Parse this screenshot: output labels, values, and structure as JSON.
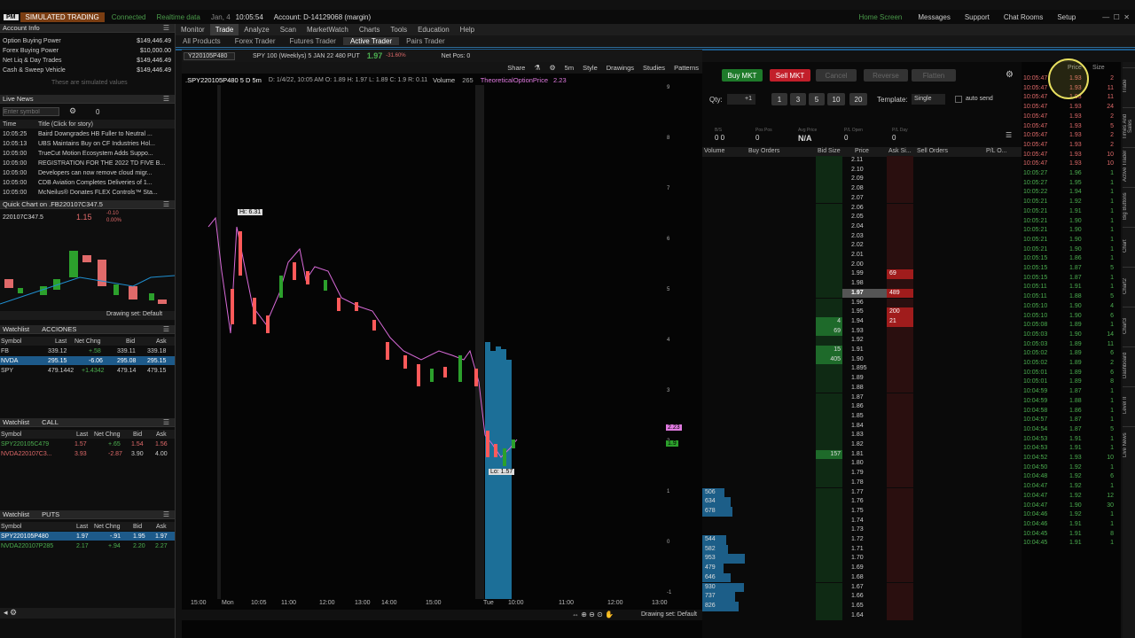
{
  "topbar": {
    "logo": "PM",
    "mode": "SIMULATED TRADING",
    "status": "Connected",
    "realtime": "Realtime data",
    "date": "Jan, 4",
    "time": "10:05:54",
    "account": "Account: D-14129068 (margin)",
    "home": "Home Screen",
    "messages": "Messages",
    "support": "Support",
    "chat": "Chat Rooms",
    "setup": "Setup"
  },
  "menu": [
    "Monitor",
    "Trade",
    "Analyze",
    "Scan",
    "MarketWatch",
    "Charts",
    "Tools",
    "Education",
    "Help"
  ],
  "subtabs": [
    "All Products",
    "Forex Trader",
    "Futures Trader",
    "Active Trader",
    "Pairs Trader"
  ],
  "account": {
    "title": "Account Info",
    "rows": [
      {
        "l": "Option Buying Power",
        "v": "$149,446.49"
      },
      {
        "l": "Forex Buying Power",
        "v": "$10,000.00"
      },
      {
        "l": "Net Liq & Day Trades",
        "v": "$149,446.49"
      },
      {
        "l": "Cash & Sweep Vehicle",
        "v": "$149,446.49"
      }
    ],
    "note": "These are simulated values"
  },
  "news": {
    "title": "Live News",
    "placeholder": "Enter symbol",
    "count": "0",
    "col_time": "Time",
    "col_title": "Title (Click for story)",
    "items": [
      {
        "t": "10:05:25",
        "h": "Baird Downgrades HB Fuller to Neutral ..."
      },
      {
        "t": "10:05:13",
        "h": "UBS Maintains Buy on CF Industries Hol..."
      },
      {
        "t": "10:05:00",
        "h": "TrueCut Motion Ecosystem Adds Suppo..."
      },
      {
        "t": "10:05:00",
        "h": "REGISTRATION FOR THE 2022 TD FIVE B..."
      },
      {
        "t": "10:05:00",
        "h": "Developers can now remove cloud migr..."
      },
      {
        "t": "10:05:00",
        "h": "CDB Aviation Completes Deliveries of 1..."
      },
      {
        "t": "10:05:00",
        "h": "McNeilus® Donates FLEX Controls™ Sta..."
      }
    ]
  },
  "quickchart": {
    "title": "Quick Chart on .FB220107C347.5",
    "symbol": "220107C347.5",
    "price": "1.15",
    "chg": "-0.10",
    "pct": "0.00%",
    "footer": "Drawing set: Default"
  },
  "wl1": {
    "title": "Watchlist",
    "name": "ACCIONES",
    "cols": [
      "Symbol",
      "Last",
      "Net Chng",
      "Bid",
      "Ask"
    ],
    "rows": [
      [
        "FB",
        "339.12",
        "+.58",
        "339.11",
        "339.18"
      ],
      [
        "NVDA",
        "295.15",
        "-6.06",
        "295.08",
        "295.15"
      ],
      [
        "SPY",
        "479.1442",
        "+1.4342",
        "479.14",
        "479.15"
      ]
    ]
  },
  "wl2": {
    "title": "Watchlist",
    "name": "CALL",
    "cols": [
      "Symbol",
      "Last",
      "Net Chng",
      "Bid",
      "Ask"
    ],
    "rows": [
      [
        "SPY220105C479",
        "1.57",
        "+.65",
        "1.54",
        "1.56"
      ],
      [
        "NVDA220107C3...",
        "3.93",
        "-2.87",
        "3.90",
        "4.00"
      ]
    ]
  },
  "wl3": {
    "title": "Watchlist",
    "name": "PUTS",
    "cols": [
      "Symbol",
      "Last",
      "Net Chng",
      "Bid",
      "Ask"
    ],
    "rows": [
      [
        "SPY220105P480",
        "1.97",
        "-.91",
        "1.95",
        "1.97"
      ],
      [
        "NVDA220107P285",
        "2.17",
        "+.94",
        "2.20",
        "2.27"
      ]
    ]
  },
  "chart": {
    "symbol": "Y220105P480",
    "desc": "SPY 100 (Weeklys) 5 JAN 22 480 PUT",
    "last": "1.97",
    "chg": "-31.60%",
    "netpos": "Net Pos: 0",
    "share": "Share",
    "tf": "5m",
    "style": "Style",
    "drawings": "Drawings",
    "studies": "Studies",
    "patterns": "Patterns",
    "info": ".SPY220105P480 5 D 5m",
    "ohlc": "D: 1/4/22, 10:05 AM  O: 1.89  H: 1.97  L: 1.89  C: 1.9  R: 0.11",
    "vol_label": "Volume",
    "vol": "265",
    "study": "TheoreticalOptionPrice",
    "study_val": "2.23",
    "hi": "Hi: 6.31",
    "lo": "Lo: 1.57",
    "xlabels": [
      "15:00",
      "Mon",
      "10:05",
      "11:00",
      "12:00",
      "13:00",
      "14:00",
      "15:00",
      "Tue",
      "10:00",
      "11:00",
      "12:00",
      "13:00"
    ],
    "ylabels": [
      "9",
      "8",
      "7",
      "6",
      "5",
      "4",
      "3",
      "2",
      "1",
      "0",
      "-1"
    ],
    "tag1": "2.23",
    "tag2": "1.9",
    "footer": "Drawing set: Default"
  },
  "ladder": {
    "buy": "Buy MKT",
    "sell": "Sell MKT",
    "cancel": "Cancel",
    "reverse": "Reverse",
    "flatten": "Flatten",
    "qty_label": "Qty:",
    "qty": "+1",
    "qtys": [
      "1",
      "3",
      "5",
      "10",
      "20"
    ],
    "template_label": "Template:",
    "template": "Single",
    "autosend": "auto send",
    "stats": [
      {
        "l": "B/S",
        "v": "0  0"
      },
      {
        "l": "Pos Pos",
        "v": "0"
      },
      {
        "l": "Avg Price",
        "v": "N/A"
      },
      {
        "l": "P/L Open",
        "v": "0"
      },
      {
        "l": "P/L Day",
        "v": "0"
      }
    ],
    "cols": [
      "Volume",
      "Buy Orders",
      "Bid Size",
      "Price",
      "Ask Si...",
      "Sell Orders",
      "P/L O..."
    ],
    "rows": [
      {
        "p": "2.11"
      },
      {
        "p": "2.10"
      },
      {
        "p": "2.09"
      },
      {
        "p": "2.08"
      },
      {
        "p": "2.07"
      },
      {
        "p": "2.06"
      },
      {
        "p": "2.05"
      },
      {
        "p": "2.04"
      },
      {
        "p": "2.03"
      },
      {
        "p": "2.02"
      },
      {
        "p": "2.01"
      },
      {
        "p": "2.00"
      },
      {
        "p": "1.99",
        "a": "69"
      },
      {
        "p": "1.98"
      },
      {
        "p": "1.97",
        "a": "489",
        "cur": true
      },
      {
        "p": "1.96"
      },
      {
        "p": "1.95",
        "a": "200"
      },
      {
        "p": "1.94",
        "b": "4",
        "a": "21"
      },
      {
        "p": "1.93",
        "b": "69"
      },
      {
        "p": "1.92"
      },
      {
        "p": "1.91",
        "b": "15"
      },
      {
        "p": "1.90",
        "b": "405"
      },
      {
        "p": "1.895"
      },
      {
        "p": "1.89"
      },
      {
        "p": "1.88"
      },
      {
        "p": "1.87"
      },
      {
        "p": "1.86"
      },
      {
        "p": "1.85"
      },
      {
        "p": "1.84"
      },
      {
        "p": "1.83"
      },
      {
        "p": "1.82"
      },
      {
        "p": "1.81",
        "b": "157"
      },
      {
        "p": "1.80"
      },
      {
        "p": "1.79"
      },
      {
        "p": "1.78"
      },
      {
        "p": "1.77",
        "v": "506"
      },
      {
        "p": "1.76",
        "v": "634"
      },
      {
        "p": "1.75",
        "v": "678"
      },
      {
        "p": "1.74"
      },
      {
        "p": "1.73"
      },
      {
        "p": "1.72",
        "v": "544"
      },
      {
        "p": "1.71",
        "v": "582"
      },
      {
        "p": "1.70",
        "v": "953"
      },
      {
        "p": "1.69",
        "v": "479"
      },
      {
        "p": "1.68",
        "v": "646"
      },
      {
        "p": "1.67",
        "v": "930"
      },
      {
        "p": "1.66",
        "v": "737"
      },
      {
        "p": "1.65",
        "v": "826"
      },
      {
        "p": "1.64"
      }
    ]
  },
  "ts": {
    "col_price": "Price",
    "col_size": "Size",
    "rows": [
      [
        "10:05:47",
        "1.93",
        "2"
      ],
      [
        "10:05:47",
        "1.93",
        "11"
      ],
      [
        "10:05:47",
        "1.93",
        "11"
      ],
      [
        "10:05:47",
        "1.93",
        "24"
      ],
      [
        "10:05:47",
        "1.93",
        "2"
      ],
      [
        "10:05:47",
        "1.93",
        "5"
      ],
      [
        "10:05:47",
        "1.93",
        "2"
      ],
      [
        "10:05:47",
        "1.93",
        "2"
      ],
      [
        "10:05:47",
        "1.93",
        "10"
      ],
      [
        "10:05:47",
        "1.93",
        "10"
      ],
      [
        "10:05:27",
        "1.96",
        "1"
      ],
      [
        "10:05:27",
        "1.95",
        "1"
      ],
      [
        "10:05:22",
        "1.94",
        "1"
      ],
      [
        "10:05:21",
        "1.92",
        "1"
      ],
      [
        "10:05:21",
        "1.91",
        "1"
      ],
      [
        "10:05:21",
        "1.90",
        "1"
      ],
      [
        "10:05:21",
        "1.90",
        "1"
      ],
      [
        "10:05:21",
        "1.90",
        "1"
      ],
      [
        "10:05:21",
        "1.90",
        "1"
      ],
      [
        "10:05:15",
        "1.86",
        "1"
      ],
      [
        "10:05:15",
        "1.87",
        "5"
      ],
      [
        "10:05:15",
        "1.87",
        "1"
      ],
      [
        "10:05:11",
        "1.91",
        "1"
      ],
      [
        "10:05:11",
        "1.88",
        "5"
      ],
      [
        "10:05:10",
        "1.90",
        "4"
      ],
      [
        "10:05:10",
        "1.90",
        "6"
      ],
      [
        "10:05:08",
        "1.89",
        "1"
      ],
      [
        "10:05:03",
        "1.90",
        "14"
      ],
      [
        "10:05:03",
        "1.89",
        "11"
      ],
      [
        "10:05:02",
        "1.89",
        "6"
      ],
      [
        "10:05:02",
        "1.89",
        "2"
      ],
      [
        "10:05:01",
        "1.89",
        "6"
      ],
      [
        "10:05:01",
        "1.89",
        "8"
      ],
      [
        "10:04:59",
        "1.87",
        "1"
      ],
      [
        "10:04:59",
        "1.88",
        "1"
      ],
      [
        "10:04:58",
        "1.86",
        "1"
      ],
      [
        "10:04:57",
        "1.87",
        "1"
      ],
      [
        "10:04:54",
        "1.87",
        "5"
      ],
      [
        "10:04:53",
        "1.91",
        "1"
      ],
      [
        "10:04:53",
        "1.91",
        "1"
      ],
      [
        "10:04:52",
        "1.93",
        "10"
      ],
      [
        "10:04:50",
        "1.92",
        "1"
      ],
      [
        "10:04:48",
        "1.92",
        "6"
      ],
      [
        "10:04:47",
        "1.92",
        "1"
      ],
      [
        "10:04:47",
        "1.92",
        "12"
      ],
      [
        "10:04:47",
        "1.90",
        "30"
      ],
      [
        "10:04:46",
        "1.92",
        "1"
      ],
      [
        "10:04:46",
        "1.91",
        "1"
      ],
      [
        "10:04:45",
        "1.91",
        "8"
      ],
      [
        "10:04:45",
        "1.91",
        "1"
      ]
    ]
  },
  "sidetabs": [
    "Trade",
    "Times And Sales",
    "Active Trader",
    "Big Buttons",
    "Chart",
    "Chart2",
    "Chart3",
    "Dashboard",
    "Level II",
    "Live News"
  ]
}
